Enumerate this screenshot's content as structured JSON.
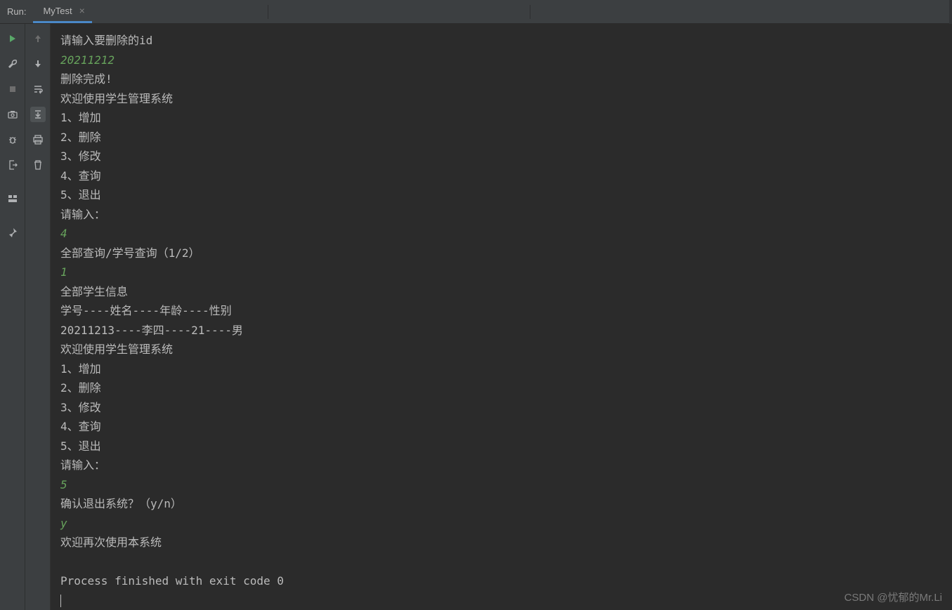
{
  "header": {
    "run_label": "Run:",
    "tab_name": "MyTest"
  },
  "console": {
    "lines": [
      {
        "text": "请输入要删除的id",
        "type": "out"
      },
      {
        "text": "20211212",
        "type": "in"
      },
      {
        "text": "删除完成!",
        "type": "out"
      },
      {
        "text": "欢迎使用学生管理系统",
        "type": "out"
      },
      {
        "text": "1、增加",
        "type": "out"
      },
      {
        "text": "2、删除",
        "type": "out"
      },
      {
        "text": "3、修改",
        "type": "out"
      },
      {
        "text": "4、查询",
        "type": "out"
      },
      {
        "text": "5、退出",
        "type": "out"
      },
      {
        "text": "请输入：",
        "type": "out"
      },
      {
        "text": "4",
        "type": "in"
      },
      {
        "text": "全部查询/学号查询（1/2）",
        "type": "out"
      },
      {
        "text": "1",
        "type": "in"
      },
      {
        "text": "全部学生信息",
        "type": "out"
      },
      {
        "text": "学号----姓名----年龄----性别",
        "type": "out"
      },
      {
        "text": "20211213----李四----21----男",
        "type": "out"
      },
      {
        "text": "欢迎使用学生管理系统",
        "type": "out"
      },
      {
        "text": "1、增加",
        "type": "out"
      },
      {
        "text": "2、删除",
        "type": "out"
      },
      {
        "text": "3、修改",
        "type": "out"
      },
      {
        "text": "4、查询",
        "type": "out"
      },
      {
        "text": "5、退出",
        "type": "out"
      },
      {
        "text": "请输入：",
        "type": "out"
      },
      {
        "text": "5",
        "type": "in"
      },
      {
        "text": "确认退出系统？（y/n）",
        "type": "out"
      },
      {
        "text": "y",
        "type": "in"
      },
      {
        "text": "欢迎再次使用本系统",
        "type": "out"
      },
      {
        "text": "",
        "type": "out"
      },
      {
        "text": "Process finished with exit code 0",
        "type": "out"
      }
    ]
  },
  "watermark": "CSDN @忧郁的Mr.Li"
}
